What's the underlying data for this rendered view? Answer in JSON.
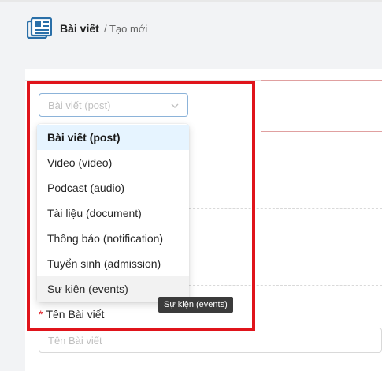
{
  "header": {
    "icon": "newspaper-icon",
    "title": "Bài viết",
    "breadcrumb": "/ Tạo mới"
  },
  "type_select": {
    "placeholder": "Bài viết (post)",
    "icon": "chevron-down-icon"
  },
  "dropdown": {
    "options": [
      {
        "label": "Bài viết (post)",
        "state": "selected"
      },
      {
        "label": "Video (video)",
        "state": "normal"
      },
      {
        "label": "Podcast (audio)",
        "state": "normal"
      },
      {
        "label": "Tài liệu (document)",
        "state": "normal"
      },
      {
        "label": "Thông báo (notification)",
        "state": "normal"
      },
      {
        "label": "Tuyển sinh (admission)",
        "state": "normal"
      },
      {
        "label": "Sự kiện (events)",
        "state": "hover"
      }
    ]
  },
  "tooltip": {
    "text": "Sự kiện (events)"
  },
  "name_field": {
    "required_mark": "*",
    "label": "Tên Bài viết",
    "placeholder": "Tên Bài viết",
    "value": ""
  },
  "colors": {
    "highlight": "#e0141b",
    "selected_bg": "#e6f4ff",
    "focus_border": "#8cb3d9",
    "icon": "#2a6fa8"
  }
}
